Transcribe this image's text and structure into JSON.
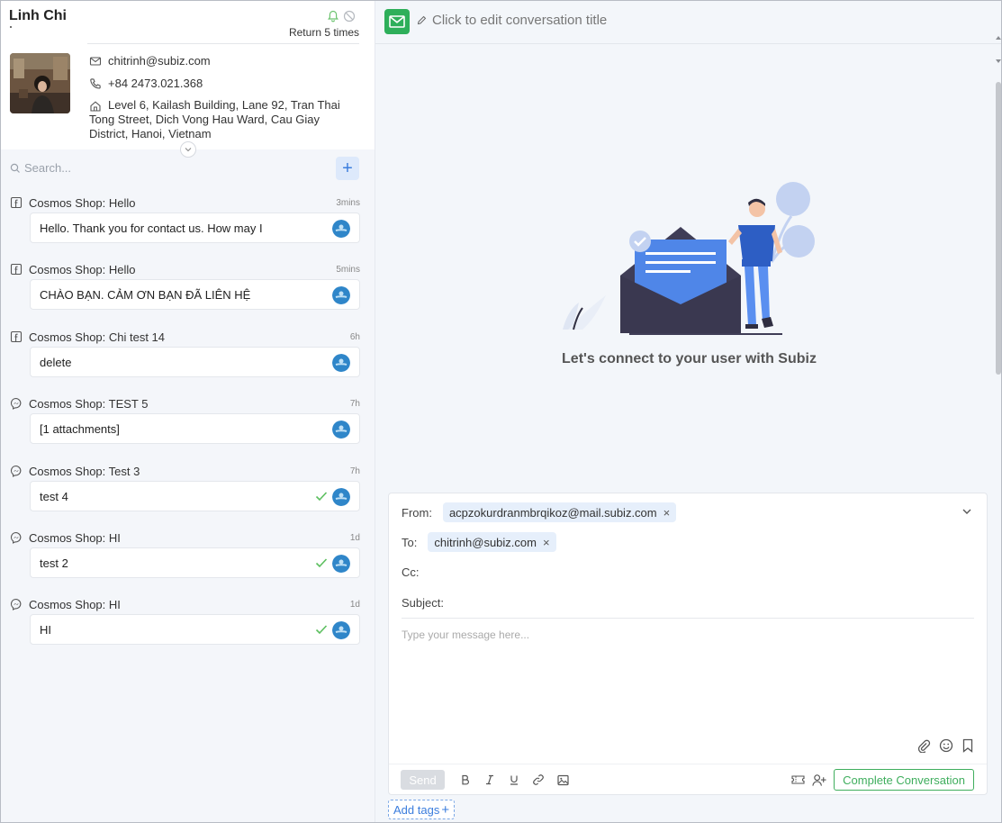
{
  "contact": {
    "name": "Linh Chi",
    "return_text": "Return 5 times",
    "email": "chitrinh@subiz.com",
    "phone": "+84 2473.021.368",
    "address": "Level 6, Kailash Building, Lane 92, Tran Thai Tong Street, Dich Vong Hau Ward, Cau Giay District, Hanoi, Vietnam"
  },
  "search": {
    "placeholder": "Search..."
  },
  "add_button_label": "+",
  "conversations": [
    {
      "source": "facebook-icon",
      "title": "Cosmos Shop: Hello",
      "time": "3mins",
      "message": "Hello. Thank you for contact us. How may I",
      "checked": false
    },
    {
      "source": "facebook-icon",
      "title": "Cosmos Shop: Hello",
      "time": "5mins",
      "message": "CHÀO BẠN. CẢM ƠN BẠN ĐÃ LIÊN HỆ",
      "checked": false
    },
    {
      "source": "facebook-icon",
      "title": "Cosmos Shop: Chi test 14",
      "time": "6h",
      "message": "delete",
      "checked": false
    },
    {
      "source": "messenger-icon",
      "title": "Cosmos Shop: TEST 5",
      "time": "7h",
      "message": "[1 attachments]",
      "checked": false
    },
    {
      "source": "messenger-icon",
      "title": "Cosmos Shop: Test 3",
      "time": "7h",
      "message": "test 4",
      "checked": true
    },
    {
      "source": "messenger-icon",
      "title": "Cosmos Shop: HI",
      "time": "1d",
      "message": "test 2",
      "checked": true
    },
    {
      "source": "messenger-icon",
      "title": "Cosmos Shop: HI",
      "time": "1d",
      "message": "HI",
      "checked": true
    }
  ],
  "header": {
    "edit_title": "Click to edit conversation title"
  },
  "empty_state": {
    "text": "Let's connect to your user with Subiz"
  },
  "composer": {
    "from_label": "From:",
    "from_value": "acpzokurdranmbrqikoz@mail.subiz.com",
    "to_label": "To:",
    "to_value": "chitrinh@subiz.com",
    "cc_label": "Cc:",
    "subject_label": "Subject:",
    "message_placeholder": "Type your message here...",
    "send_label": "Send",
    "complete_label": "Complete Conversation",
    "remove_glyph": "×"
  },
  "add_tags_label": "Add tags",
  "add_tags_plus": "+",
  "colors": {
    "accent": "#3b7ddd",
    "success": "#3fae5d",
    "mail_badge": "#2eaf5a"
  }
}
